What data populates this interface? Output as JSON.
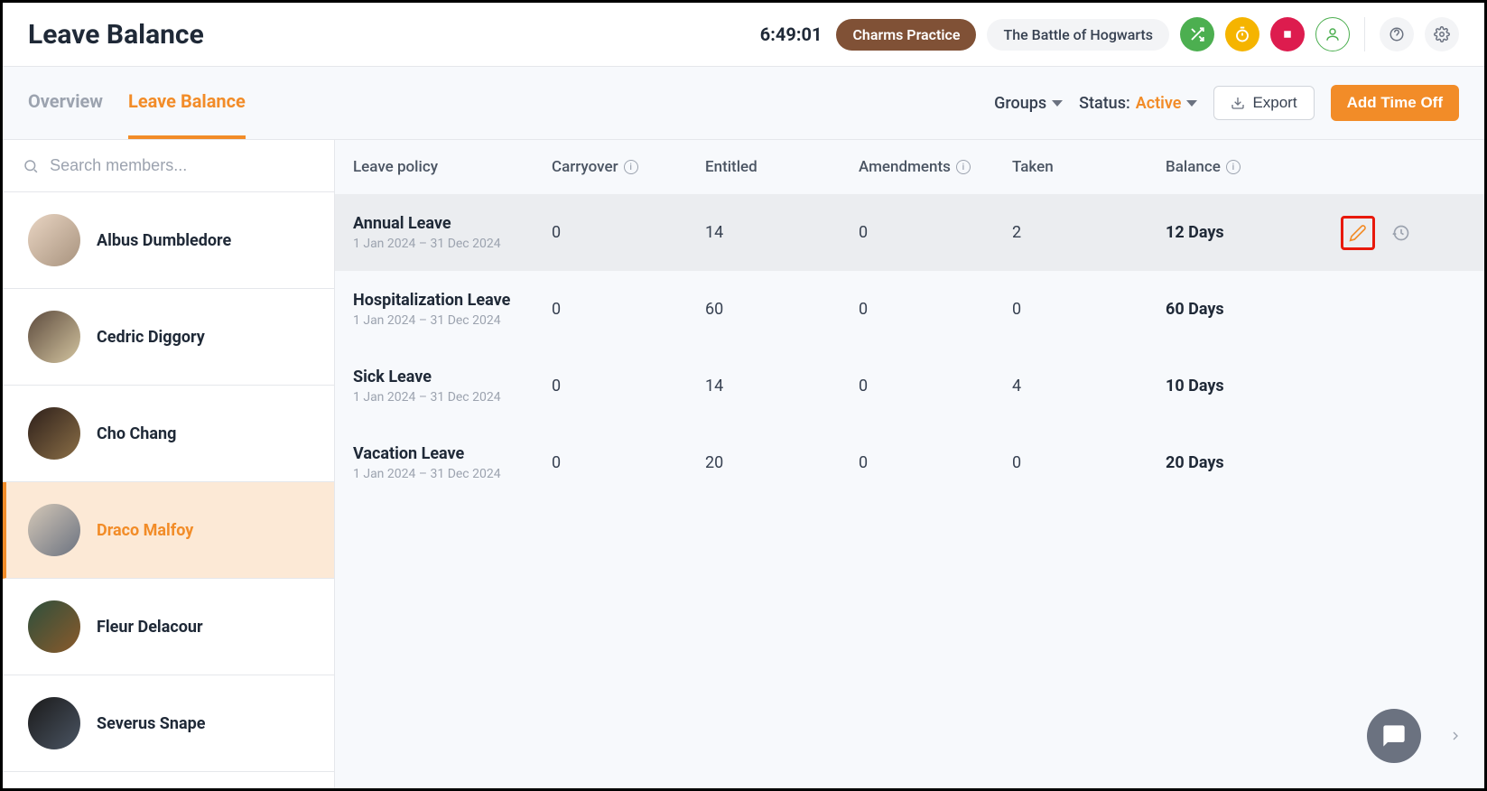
{
  "header": {
    "title": "Leave Balance",
    "timer": "6:49:01",
    "badges": [
      {
        "label": "Charms Practice",
        "style": "brown"
      },
      {
        "label": "The Battle of Hogwarts",
        "style": "gray"
      }
    ]
  },
  "tabs": [
    {
      "label": "Overview",
      "active": false
    },
    {
      "label": "Leave Balance",
      "active": true
    }
  ],
  "filters": {
    "groups_label": "Groups",
    "status_label": "Status:",
    "status_value": "Active",
    "export_label": "Export",
    "add_label": "Add Time Off"
  },
  "search": {
    "placeholder": "Search members..."
  },
  "members": [
    {
      "name": "Albus Dumbledore",
      "active": false
    },
    {
      "name": "Cedric Diggory",
      "active": false
    },
    {
      "name": "Cho Chang",
      "active": false
    },
    {
      "name": "Draco Malfoy",
      "active": true
    },
    {
      "name": "Fleur Delacour",
      "active": false
    },
    {
      "name": "Severus Snape",
      "active": false
    }
  ],
  "columns": {
    "policy": "Leave policy",
    "carryover": "Carryover",
    "entitled": "Entitled",
    "amendments": "Amendments",
    "taken": "Taken",
    "balance": "Balance"
  },
  "rows": [
    {
      "policy": "Annual Leave",
      "period": "1 Jan 2024 – 31 Dec 2024",
      "carryover": "0",
      "entitled": "14",
      "amendments": "0",
      "taken": "2",
      "balance": "12 Days",
      "highlighted": true
    },
    {
      "policy": "Hospitalization Leave",
      "period": "1 Jan 2024 – 31 Dec 2024",
      "carryover": "0",
      "entitled": "60",
      "amendments": "0",
      "taken": "0",
      "balance": "60 Days",
      "highlighted": false
    },
    {
      "policy": "Sick Leave",
      "period": "1 Jan 2024 – 31 Dec 2024",
      "carryover": "0",
      "entitled": "14",
      "amendments": "0",
      "taken": "4",
      "balance": "10 Days",
      "highlighted": false
    },
    {
      "policy": "Vacation Leave",
      "period": "1 Jan 2024 – 31 Dec 2024",
      "carryover": "0",
      "entitled": "20",
      "amendments": "0",
      "taken": "0",
      "balance": "20 Days",
      "highlighted": false
    }
  ],
  "colors": {
    "accent": "#f28c28",
    "red_highlight": "#e8190c"
  }
}
